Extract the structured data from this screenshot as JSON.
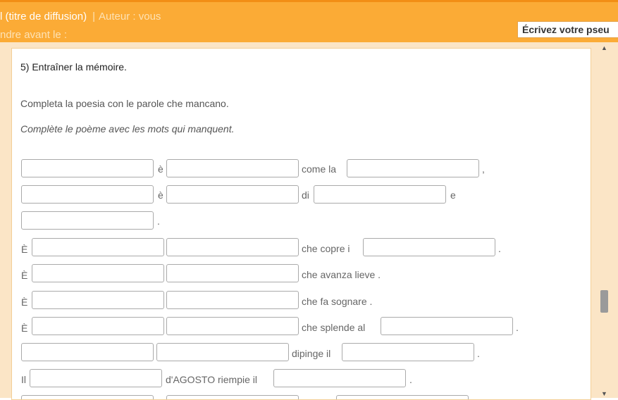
{
  "header": {
    "title": "l (titre de diffusion)",
    "separator": "|",
    "author": "Auteur : vous",
    "subtitle": "ndre avant le :",
    "pseudo_placeholder": "Écrivez votre pseu"
  },
  "exercise": {
    "heading": "5) Entraîner la mémoire.",
    "instruction_it": "Completa la poesia con le parole che mancano.",
    "instruction_fr": "Complète le poème avec les mots qui manquent.",
    "words": {
      "e_grave": "è",
      "come_la": "come la",
      "comma": ",",
      "di": "di",
      "e": "e",
      "period": ".",
      "cap_e_grave": "È",
      "che_copre_i": "che copre i",
      "che_avanza_lieve": "che avanza lieve .",
      "che_fa_sognare": "che fa sognare .",
      "che_splende_al": "che splende al",
      "dipinge_il": "dipinge il",
      "il": "Il",
      "dagosto_riempie_il": "d'AGOSTO riempie il"
    }
  }
}
